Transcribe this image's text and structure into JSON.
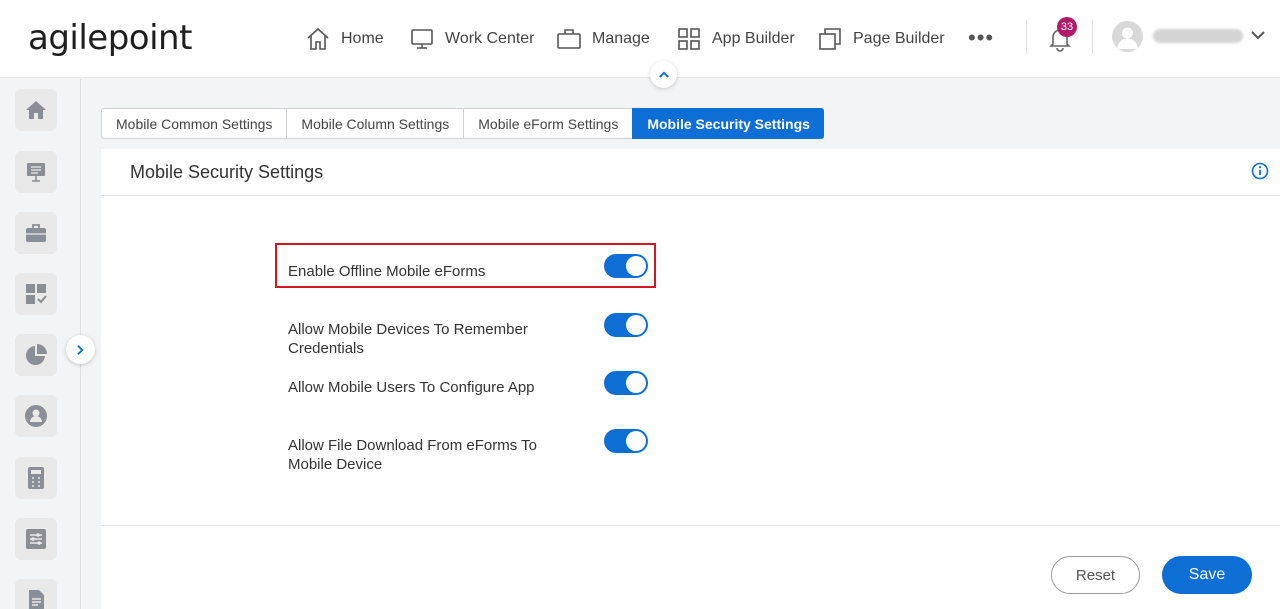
{
  "app": {
    "logo_text": "agilepoint"
  },
  "nav": {
    "home": "Home",
    "work_center": "Work Center",
    "manage": "Manage",
    "app_builder": "App Builder",
    "page_builder": "Page Builder",
    "more": "•••"
  },
  "notifications": {
    "count": "33"
  },
  "tabs": [
    {
      "label": "Mobile Common Settings"
    },
    {
      "label": "Mobile Column Settings"
    },
    {
      "label": "Mobile eForm Settings"
    },
    {
      "label": "Mobile Security Settings",
      "active": true
    }
  ],
  "panel": {
    "title": "Mobile Security Settings",
    "settings": [
      {
        "label": "Enable Offline Mobile eForms",
        "enabled": true
      },
      {
        "label": "Allow Mobile Devices To Remember Credentials",
        "enabled": true
      },
      {
        "label": "Allow Mobile Users To Configure App",
        "enabled": true
      },
      {
        "label": "Allow File Download From eForms To Mobile Device",
        "enabled": true
      }
    ]
  },
  "buttons": {
    "reset": "Reset",
    "save": "Save"
  },
  "colors": {
    "accent": "#0d6fd6",
    "badge": "#b01a6a",
    "highlight": "#d0181e"
  }
}
